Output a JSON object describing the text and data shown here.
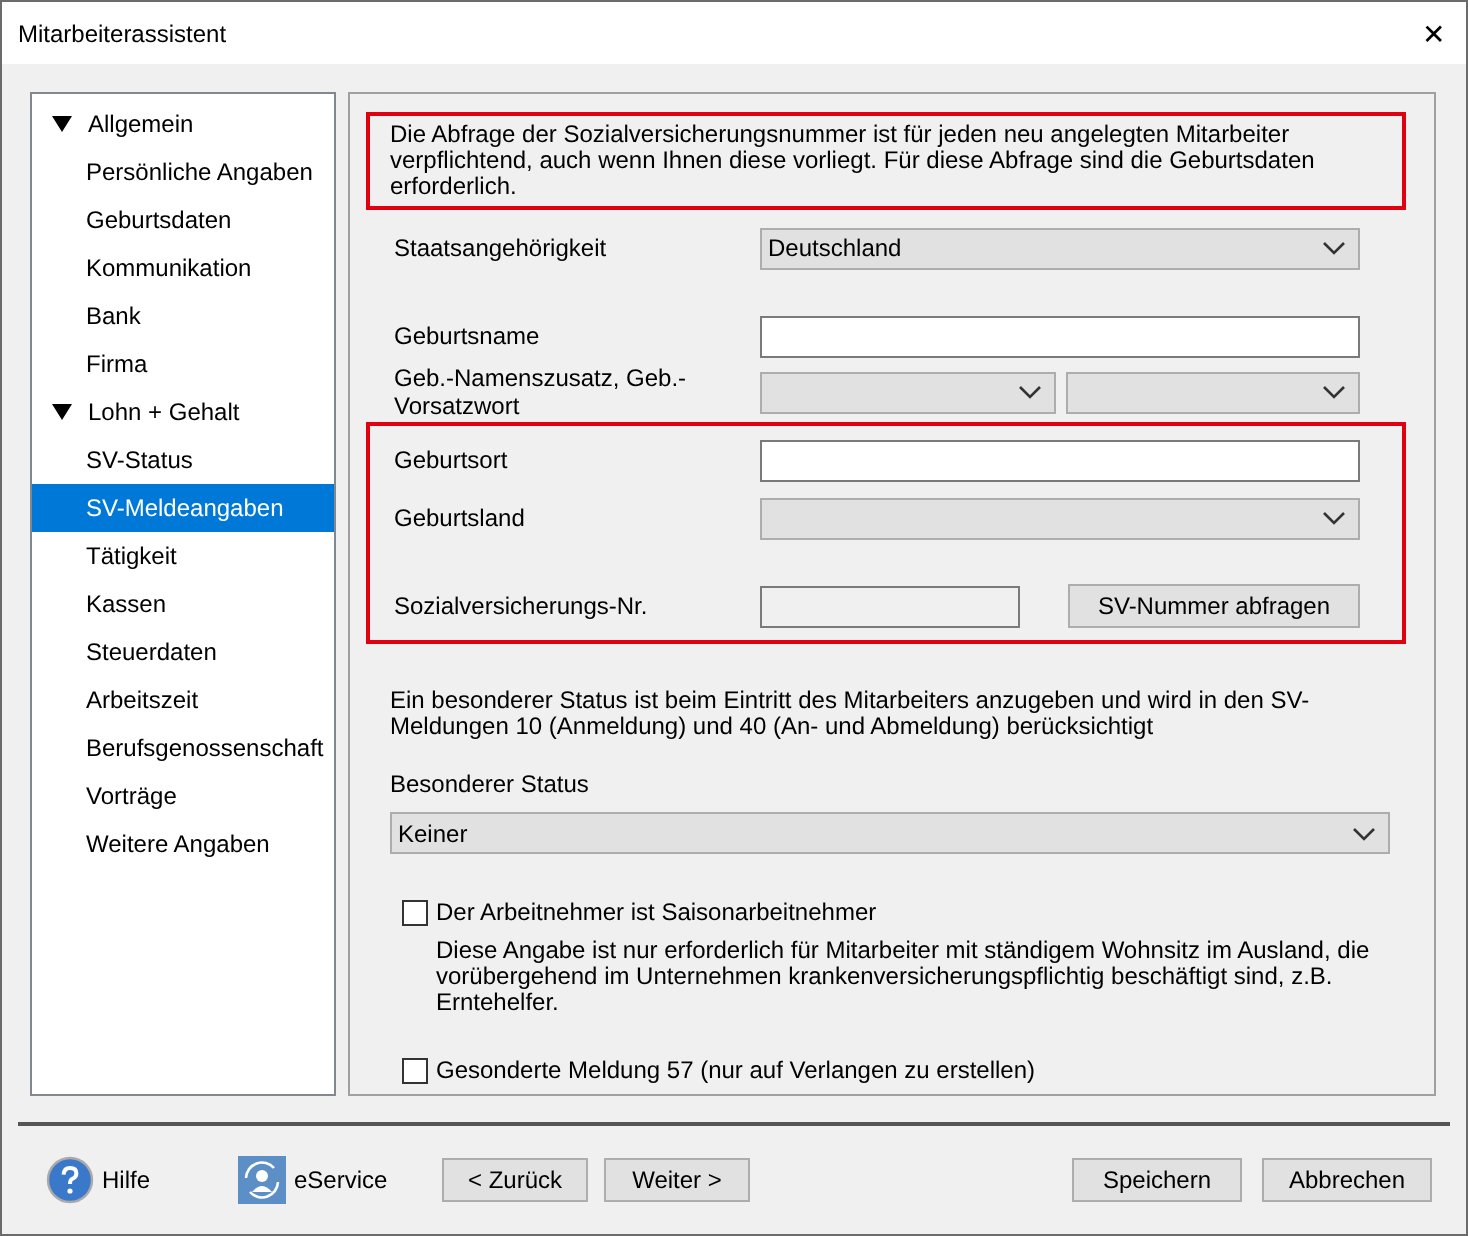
{
  "window": {
    "title": "Mitarbeiterassistent",
    "close": "✕"
  },
  "nav": [
    {
      "label": "Allgemein",
      "expanded": true,
      "children": [
        {
          "label": "Persönliche Angaben",
          "selected": false
        },
        {
          "label": "Geburtsdaten",
          "selected": false
        },
        {
          "label": "Kommunikation",
          "selected": false
        },
        {
          "label": "Bank",
          "selected": false
        },
        {
          "label": "Firma",
          "selected": false
        }
      ]
    },
    {
      "label": "Lohn + Gehalt",
      "expanded": true,
      "children": [
        {
          "label": "SV-Status",
          "selected": false
        },
        {
          "label": "SV-Meldeangaben",
          "selected": true
        },
        {
          "label": "Tätigkeit",
          "selected": false
        },
        {
          "label": "Kassen",
          "selected": false
        },
        {
          "label": "Steuerdaten",
          "selected": false
        },
        {
          "label": "Arbeitszeit",
          "selected": false
        },
        {
          "label": "Berufsgenossenschaft",
          "selected": false
        },
        {
          "label": "Vorträge",
          "selected": false
        },
        {
          "label": "Weitere Angaben",
          "selected": false
        }
      ]
    }
  ],
  "notice": "Die Abfrage der Sozialversicherungsnummer ist für jeden neu angelegten Mitarbeiter verpflichtend, auch wenn Ihnen diese vorliegt. Für diese Abfrage sind die Geburtsdaten erforderlich.",
  "fields": [
    {
      "kind": "select",
      "label": "Staatsangehörigkeit",
      "value": "Deutschland"
    },
    {
      "kind": "text",
      "label": "Geburtsname"
    },
    {
      "kind": "select-pair",
      "label": "Geb.-Namenszusatz, Geb.-Vorsatzwort"
    }
  ],
  "required_fields": [
    {
      "kind": "text",
      "label": "Geburtsort"
    },
    {
      "kind": "select",
      "label": "Geburtsland"
    },
    {
      "kind": "sv-number",
      "label": "Sozialversicherungs-Nr.",
      "button": "SV-Nummer abfragen"
    }
  ],
  "status_info": "Ein besonderer Status ist beim Eintritt des Mitarbeiters anzugeben und wird in den SV-Meldungen 10 (Anmeldung) und 40 (An- und Abmeldung) berücksichtigt",
  "status": {
    "label": "Besonderer Status",
    "value": "Keiner"
  },
  "checkboxes": [
    {
      "label": "Der Arbeitnehmer ist Saisonarbeitnehmer",
      "checked": false,
      "note": "Diese Angabe ist nur erforderlich für Mitarbeiter mit ständigem Wohnsitz im Ausland, die vorübergehend im Unternehmen krankenversicherungspflichtig beschäftigt sind, z.B. Erntehelfer."
    },
    {
      "label": "Gesonderte Meldung 57 (nur auf Verlangen zu erstellen)",
      "checked": false
    }
  ],
  "footer": {
    "help": "Hilfe",
    "eservice": "eService",
    "nav_buttons": [
      "< Zurück",
      "Weiter >"
    ],
    "action_buttons": [
      "Speichern",
      "Abbrechen"
    ]
  }
}
